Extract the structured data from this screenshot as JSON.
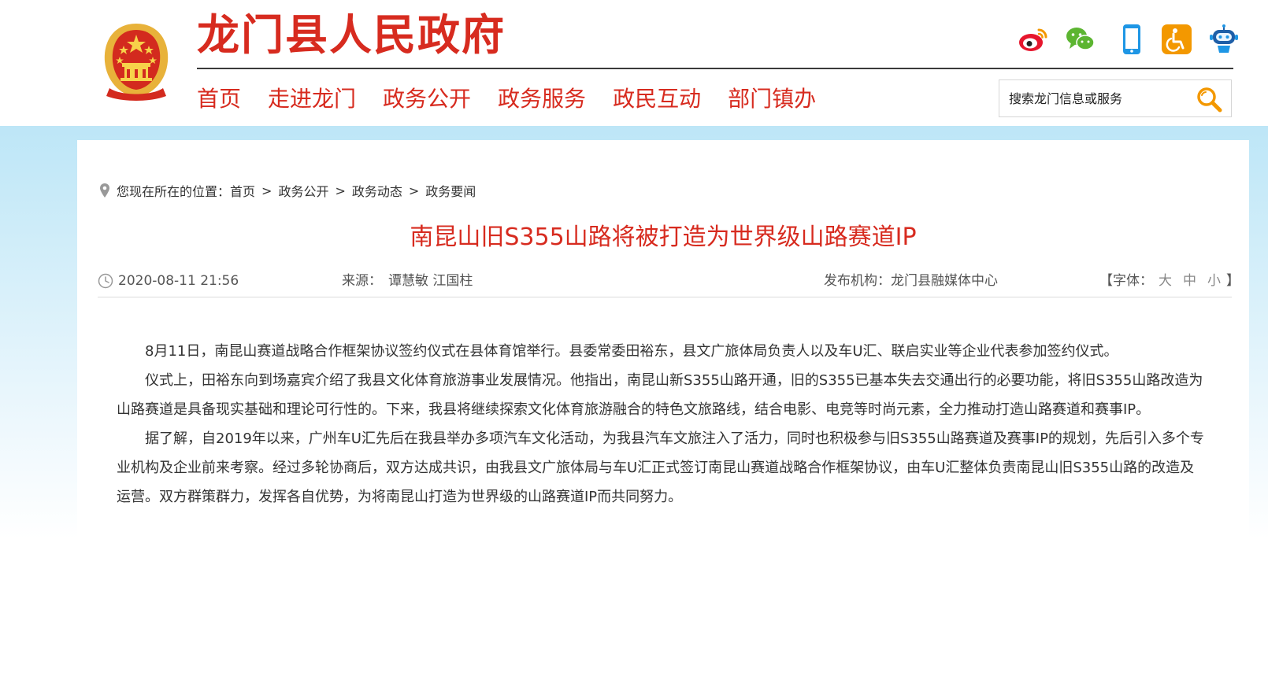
{
  "header": {
    "site_title": "龙门县人民政府",
    "social_icons": [
      "weibo-icon",
      "wechat-icon",
      "mobile-icon",
      "accessibility-icon",
      "robot-icon"
    ],
    "colors": {
      "brand_red": "#d72b1f",
      "accent_orange": "#f39800",
      "accent_blue": "#1e96e5",
      "wechat_green": "#5cb531"
    }
  },
  "nav": {
    "items": [
      "首页",
      "走进龙门",
      "政务公开",
      "政务服务",
      "政民互动",
      "部门镇办"
    ]
  },
  "search": {
    "placeholder": "搜索龙门信息或服务"
  },
  "breadcrumb": {
    "prefix": "您现在所在的位置：",
    "items": [
      "首页",
      "政务公开",
      "政务动态",
      "政务要闻"
    ],
    "separator": ">"
  },
  "article": {
    "title": "南昆山旧S355山路将被打造为世界级山路赛道IP",
    "date": "2020-08-11 21:56",
    "source_label": "来源：",
    "source_value": "谭慧敏 江国柱",
    "publisher_label": "发布机构：",
    "publisher_value": "龙门县融媒体中心",
    "font_label": "【字体：",
    "font_large": "大",
    "font_medium": "中",
    "font_small": "小",
    "font_close": "】",
    "paragraphs": [
      "8月11日，南昆山赛道战略合作框架协议签约仪式在县体育馆举行。县委常委田裕东，县文广旅体局负责人以及车U汇、联启实业等企业代表参加签约仪式。",
      "仪式上，田裕东向到场嘉宾介绍了我县文化体育旅游事业发展情况。他指出，南昆山新S355山路开通，旧的S355已基本失去交通出行的必要功能，将旧S355山路改造为山路赛道是具备现实基础和理论可行性的。下来，我县将继续探索文化体育旅游融合的特色文旅路线，结合电影、电竞等时尚元素，全力推动打造山路赛道和赛事IP。",
      "据了解，自2019年以来，广州车U汇先后在我县举办多项汽车文化活动，为我县汽车文旅注入了活力，同时也积极参与旧S355山路赛道及赛事IP的规划，先后引入多个专业机构及企业前来考察。经过多轮协商后，双方达成共识，由我县文广旅体局与车U汇正式签订南昆山赛道战略合作框架协议，由车U汇整体负责南昆山旧S355山路的改造及运营。双方群策群力，发挥各自优势，为将南昆山打造为世界级的山路赛道IP而共同努力。"
    ]
  }
}
